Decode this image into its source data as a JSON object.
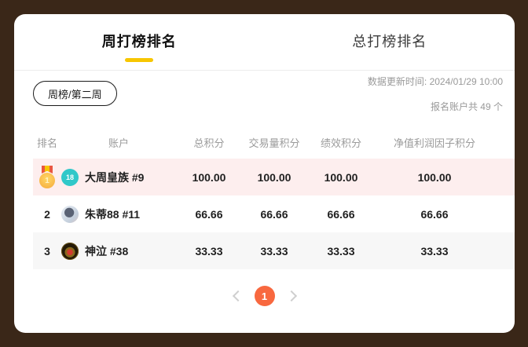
{
  "tabs": [
    {
      "label": "周打榜排名",
      "active": true
    },
    {
      "label": "总打榜排名",
      "active": false
    }
  ],
  "filter_pill_label": "周榜/第二周",
  "meta": {
    "update_time": "数据更新时间: 2024/01/29 10:00",
    "accounts_total": "报名账户共 49 个"
  },
  "table": {
    "headers": [
      "排名",
      "账户",
      "总积分",
      "交易量积分",
      "绩效积分",
      "净值利润因子积分"
    ],
    "rows": [
      {
        "rank": "1",
        "medal": true,
        "avatar": {
          "type": "level-badge",
          "text": "18"
        },
        "name": "大周皇族 #9",
        "scores": [
          "100.00",
          "100.00",
          "100.00",
          "100.00"
        ],
        "highlight": "pink"
      },
      {
        "rank": "2",
        "medal": false,
        "avatar": {
          "type": "photo-light",
          "text": ""
        },
        "name": "朱蒂88 #11",
        "scores": [
          "66.66",
          "66.66",
          "66.66",
          "66.66"
        ],
        "highlight": "white"
      },
      {
        "rank": "3",
        "medal": false,
        "avatar": {
          "type": "photo-dark",
          "text": ""
        },
        "name": "神泣 #38",
        "scores": [
          "33.33",
          "33.33",
          "33.33",
          "33.33"
        ],
        "highlight": "gray"
      }
    ]
  },
  "pagination": {
    "current_page": "1"
  },
  "colors": {
    "frame_brown": "#3A2718",
    "accent_yellow": "#F7C600",
    "highlight_pink": "#FDEEEE",
    "row_gray": "#F7F7F7",
    "pagination_orange": "#F8683F",
    "badge_teal": "#30C8C9",
    "medal_gold": "#F5A93B",
    "medal_ribbon_red": "#E9573F"
  }
}
